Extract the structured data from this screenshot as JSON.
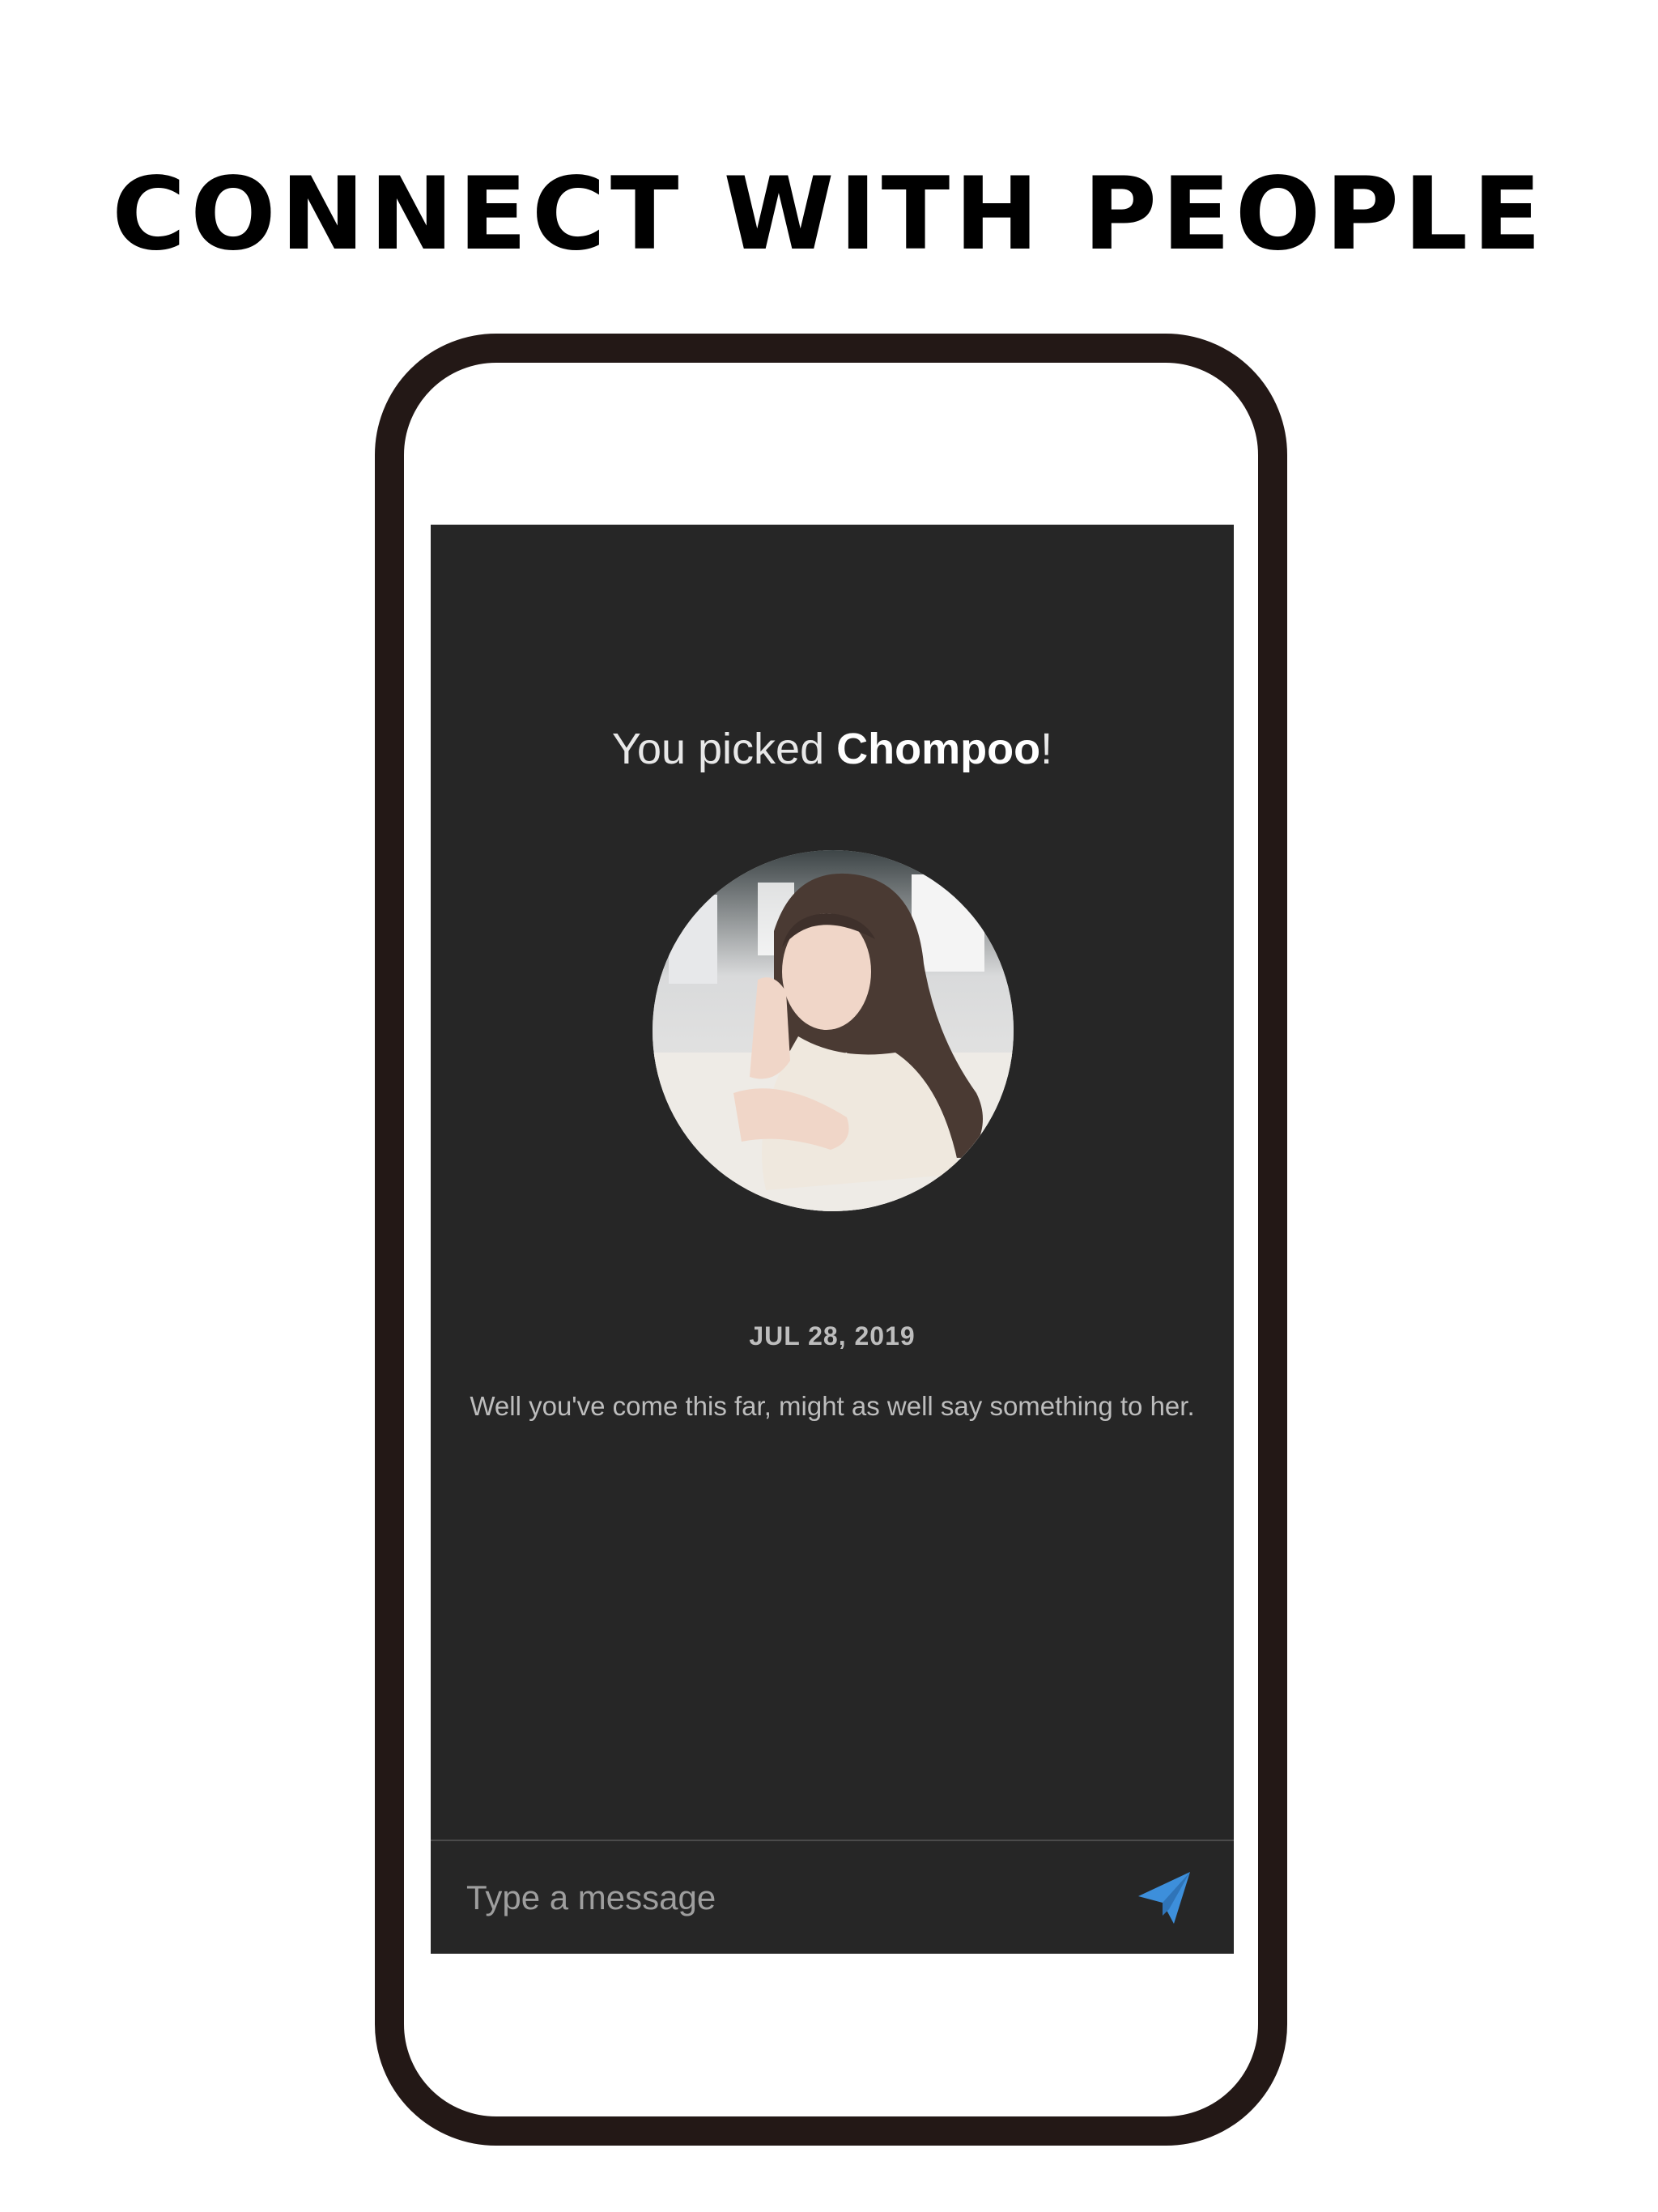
{
  "headline": "CONNECT WITH PEOPLE",
  "chat": {
    "picked_prefix": "You picked ",
    "picked_name": "Chompoo",
    "picked_suffix": "!",
    "date": "JUL 28, 2019",
    "prompt": "Well you've come this far, might as well say something to her.",
    "avatar_icon": "profile-photo",
    "composer": {
      "placeholder": "Type a message",
      "value": "",
      "send_icon": "paper-plane-icon",
      "send_color": "#3d8fdb"
    }
  },
  "colors": {
    "screen_bg": "#262626",
    "frame": "#231816",
    "accent": "#3d8fdb"
  }
}
